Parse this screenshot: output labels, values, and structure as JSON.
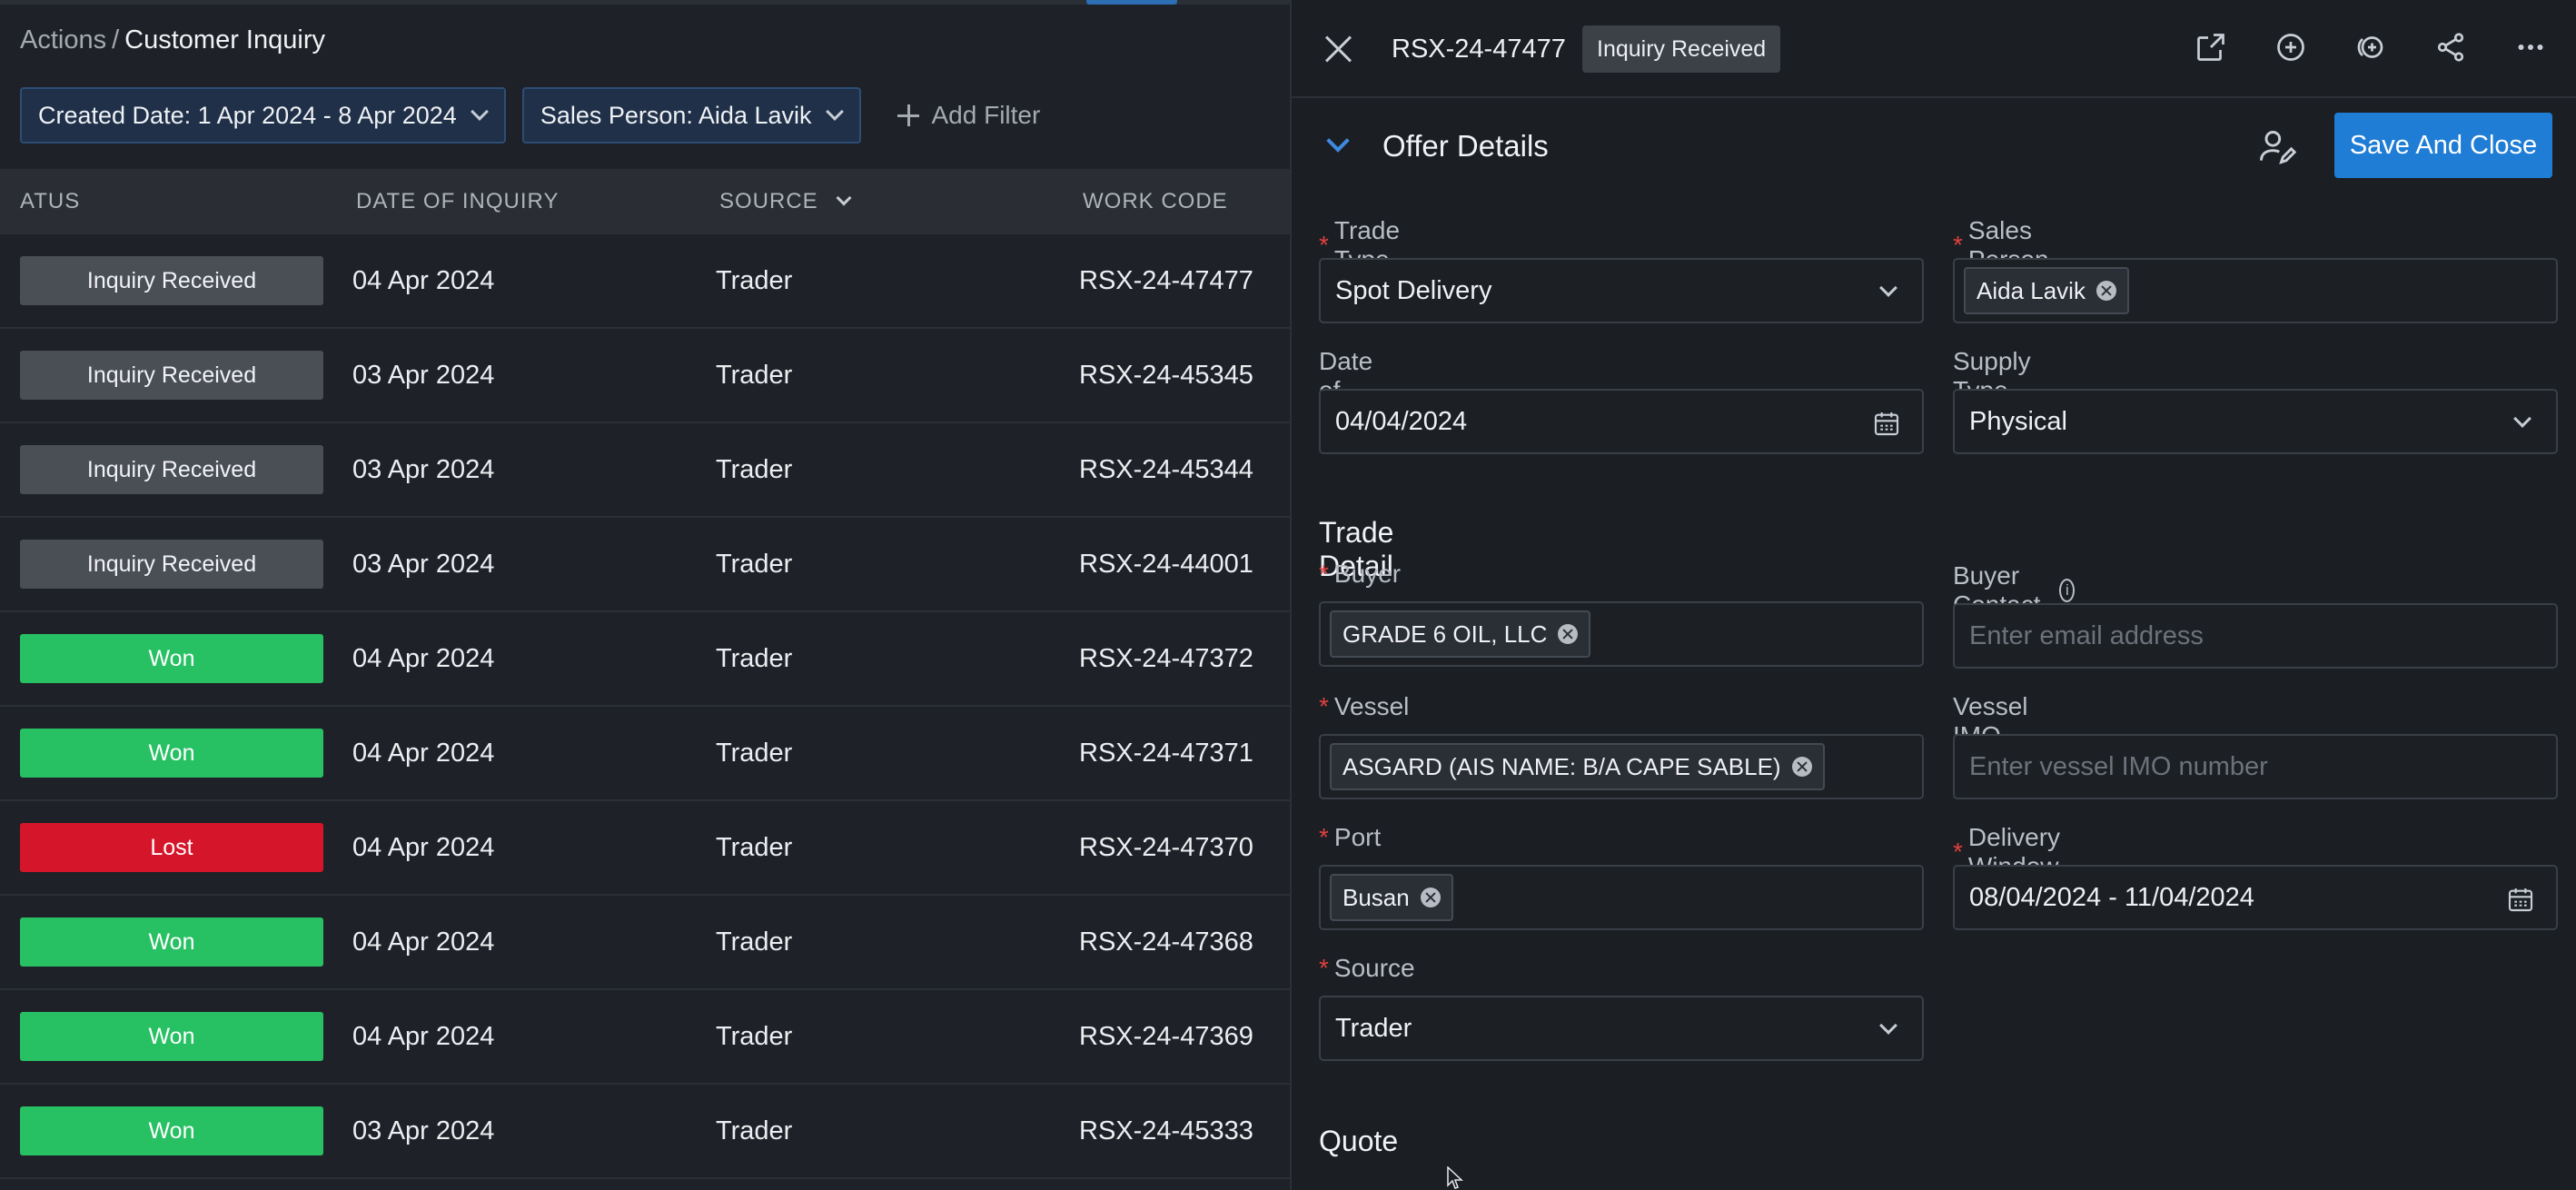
{
  "breadcrumb": {
    "parent": "Actions",
    "separator": "/",
    "current": "Customer Inquiry"
  },
  "filters": [
    {
      "label": "Created Date: 1 Apr 2024 - 8 Apr 2024"
    },
    {
      "label": "Sales Person: Aida Lavik"
    }
  ],
  "add_filter_label": "Add Filter",
  "table": {
    "headers": {
      "status": "ATUS",
      "date": "DATE OF INQUIRY",
      "source": "SOURCE",
      "code": "WORK CODE"
    },
    "rows": [
      {
        "status": "Inquiry Received",
        "date": "04 Apr 2024",
        "source": "Trader",
        "code": "RSX-24-47477"
      },
      {
        "status": "Inquiry Received",
        "date": "03 Apr 2024",
        "source": "Trader",
        "code": "RSX-24-45345"
      },
      {
        "status": "Inquiry Received",
        "date": "03 Apr 2024",
        "source": "Trader",
        "code": "RSX-24-45344"
      },
      {
        "status": "Inquiry Received",
        "date": "03 Apr 2024",
        "source": "Trader",
        "code": "RSX-24-44001"
      },
      {
        "status": "Won",
        "date": "04 Apr 2024",
        "source": "Trader",
        "code": "RSX-24-47372"
      },
      {
        "status": "Won",
        "date": "04 Apr 2024",
        "source": "Trader",
        "code": "RSX-24-47371"
      },
      {
        "status": "Lost",
        "date": "04 Apr 2024",
        "source": "Trader",
        "code": "RSX-24-47370"
      },
      {
        "status": "Won",
        "date": "04 Apr 2024",
        "source": "Trader",
        "code": "RSX-24-47368"
      },
      {
        "status": "Won",
        "date": "04 Apr 2024",
        "source": "Trader",
        "code": "RSX-24-47369"
      },
      {
        "status": "Won",
        "date": "03 Apr 2024",
        "source": "Trader",
        "code": "RSX-24-45333"
      }
    ]
  },
  "status_colors": {
    "Inquiry Received": "#4a4e55",
    "Won": "#27c063",
    "Lost": "#d5152a"
  },
  "detail": {
    "code": "RSX-24-47477",
    "badge": "Inquiry Received",
    "header_icons": [
      "open-external-icon",
      "add-circle-icon",
      "add-linked-icon",
      "share-icon",
      "more-icon"
    ],
    "section_title": "Offer Details",
    "save_label": "Save And Close",
    "accent_color": "#1f7dd6",
    "trade_type": {
      "label": "Trade Type",
      "value": "Spot Delivery"
    },
    "sales_person": {
      "label": "Sales Person",
      "value": "Aida Lavik"
    },
    "date_of_inquiry": {
      "label": "Date of Inquiry",
      "value": "04/04/2024"
    },
    "supply_type": {
      "label": "Supply Type",
      "value": "Physical"
    },
    "trade_detail_title": "Trade Detail",
    "buyer": {
      "label": "Buyer",
      "value": "GRADE 6 OIL, LLC"
    },
    "buyer_contact": {
      "label": "Buyer Contact",
      "placeholder": "Enter email address"
    },
    "vessel": {
      "label": "Vessel",
      "value": "ASGARD (AIS NAME: B/A CAPE SABLE)"
    },
    "vessel_imo": {
      "label": "Vessel IMO",
      "placeholder": "Enter vessel IMO number"
    },
    "port": {
      "label": "Port",
      "value": "Busan"
    },
    "delivery_window": {
      "label": "Delivery Window",
      "value": "08/04/2024 - 11/04/2024"
    },
    "source": {
      "label": "Source",
      "value": "Trader"
    },
    "quote_title": "Quote"
  }
}
